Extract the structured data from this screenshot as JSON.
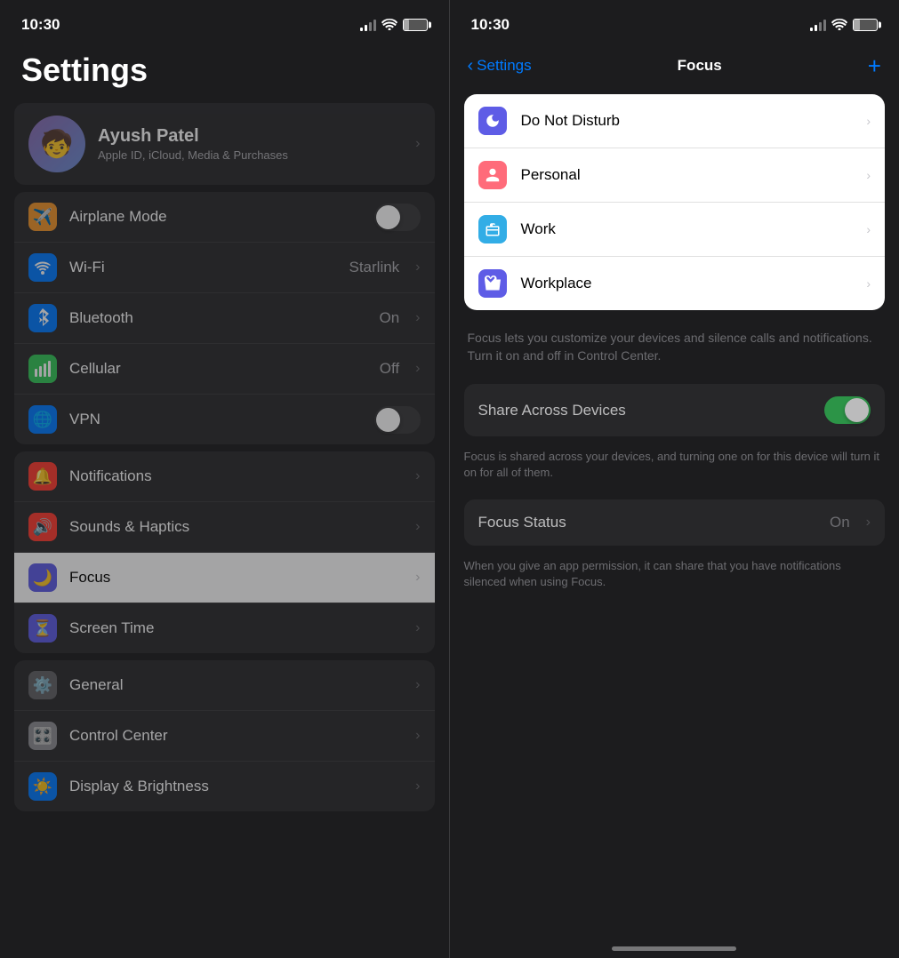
{
  "left": {
    "status": {
      "time": "10:30"
    },
    "title": "Settings",
    "profile": {
      "name": "Ayush Patel",
      "sub": "Apple ID, iCloud, Media & Purchases",
      "emoji": "🧒"
    },
    "section1": {
      "items": [
        {
          "id": "airplane",
          "icon": "✈️",
          "iconBg": "orange",
          "label": "Airplane Mode",
          "type": "toggle"
        },
        {
          "id": "wifi",
          "icon": "📶",
          "iconBg": "blue",
          "label": "Wi-Fi",
          "value": "Starlink",
          "type": "chevron"
        },
        {
          "id": "bluetooth",
          "icon": "🔷",
          "iconBg": "blue",
          "label": "Bluetooth",
          "value": "On",
          "type": "chevron"
        },
        {
          "id": "cellular",
          "icon": "📡",
          "iconBg": "green",
          "label": "Cellular",
          "value": "Off",
          "type": "chevron"
        },
        {
          "id": "vpn",
          "icon": "🌐",
          "iconBg": "blue",
          "label": "VPN",
          "type": "toggle"
        }
      ]
    },
    "section2": {
      "items": [
        {
          "id": "notifications",
          "icon": "🔔",
          "iconBg": "red",
          "label": "Notifications",
          "type": "chevron"
        },
        {
          "id": "sounds",
          "icon": "🔊",
          "iconBg": "red",
          "label": "Sounds & Haptics",
          "type": "chevron"
        },
        {
          "id": "focus",
          "icon": "🌙",
          "iconBg": "purple",
          "label": "Focus",
          "type": "chevron",
          "highlighted": true
        },
        {
          "id": "screentime",
          "icon": "⏳",
          "iconBg": "purple",
          "label": "Screen Time",
          "type": "chevron"
        }
      ]
    },
    "section3": {
      "items": [
        {
          "id": "general",
          "icon": "⚙️",
          "iconBg": "gray",
          "label": "General",
          "type": "chevron"
        },
        {
          "id": "controlcenter",
          "icon": "🎛️",
          "iconBg": "gray",
          "label": "Control Center",
          "type": "chevron"
        },
        {
          "id": "displaybrightness",
          "icon": "☀️",
          "iconBg": "blue",
          "label": "Display & Brightness",
          "type": "chevron"
        }
      ]
    }
  },
  "right": {
    "status": {
      "time": "10:30"
    },
    "nav": {
      "back": "Settings",
      "title": "Focus",
      "add": "+"
    },
    "focus_items": [
      {
        "id": "donotdisturb",
        "label": "Do Not Disturb",
        "emoji": "🌙",
        "iconBg": "purple"
      },
      {
        "id": "personal",
        "label": "Personal",
        "emoji": "🧑",
        "iconBg": "pink"
      },
      {
        "id": "work",
        "label": "Work",
        "emoji": "💼",
        "iconBg": "teal"
      },
      {
        "id": "workplace",
        "label": "Workplace",
        "emoji": "💼",
        "iconBg": "purple"
      }
    ],
    "description": "Focus lets you customize your devices and silence calls and notifications. Turn it on and off in Control Center.",
    "share_label": "Share Across Devices",
    "share_sub": "Focus is shared across your devices, and turning one on for this device will turn it on for all of them.",
    "status_label": "Focus Status",
    "status_value": "On",
    "status_sub": "When you give an app permission, it can share that you have notifications silenced when using Focus."
  }
}
